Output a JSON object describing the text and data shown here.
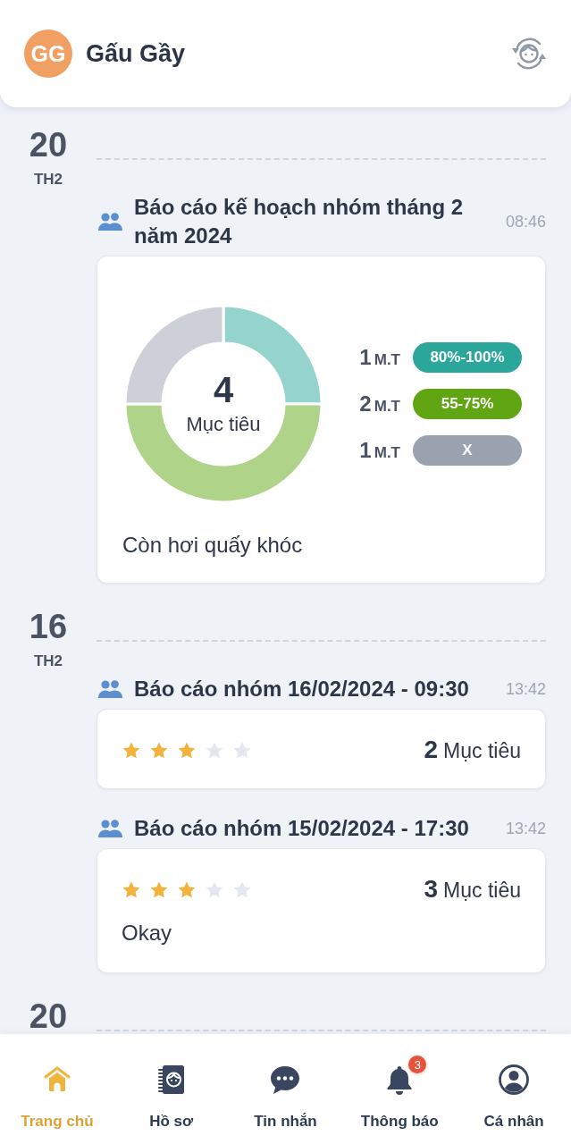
{
  "header": {
    "avatar_initials": "GG",
    "name": "Gấu Gầy"
  },
  "timeline": [
    {
      "day": "20",
      "weekday": "TH2",
      "reports": [
        {
          "kind": "chart",
          "title": "Báo cáo kế hoạch nhóm tháng 2 năm 2024",
          "time": "08:46",
          "total": "4",
          "total_label": "Mục tiêu",
          "chart_data": {
            "type": "donut",
            "categories": [
              "80%-100%",
              "55-75%",
              "X"
            ],
            "values": [
              25,
              50,
              25
            ]
          },
          "legend": [
            {
              "count": "1",
              "unit": "M.T",
              "color": "#2aa79a"
            },
            {
              "count": "2",
              "unit": "M.T",
              "color": "#5fa612"
            },
            {
              "count": "1",
              "unit": "M.T",
              "color": "#9aa2af"
            }
          ],
          "note": "Còn hơi quấy khóc"
        }
      ]
    },
    {
      "day": "16",
      "weekday": "TH2",
      "reports": [
        {
          "kind": "stars",
          "title": "Báo cáo nhóm 16/02/2024 - 09:30",
          "time": "13:42",
          "stars": 3,
          "goal_count": "2",
          "goal_label": "Mục tiêu"
        },
        {
          "kind": "stars",
          "title": "Báo cáo nhóm 15/02/2024 - 17:30",
          "time": "13:42",
          "stars": 3,
          "goal_count": "3",
          "goal_label": "Mục tiêu",
          "note": "Okay"
        }
      ]
    },
    {
      "day": "20"
    }
  ],
  "bottom_nav": [
    {
      "kind": "home",
      "label": "Trang chủ",
      "selected": true
    },
    {
      "kind": "profile",
      "label": "Hồ sơ",
      "selected": false
    },
    {
      "kind": "messages",
      "label": "Tin nhắn",
      "selected": false
    },
    {
      "kind": "notifications",
      "label": "Thông báo",
      "selected": false,
      "badge": "3"
    },
    {
      "kind": "account",
      "label": "Cá nhân",
      "selected": false
    }
  ]
}
